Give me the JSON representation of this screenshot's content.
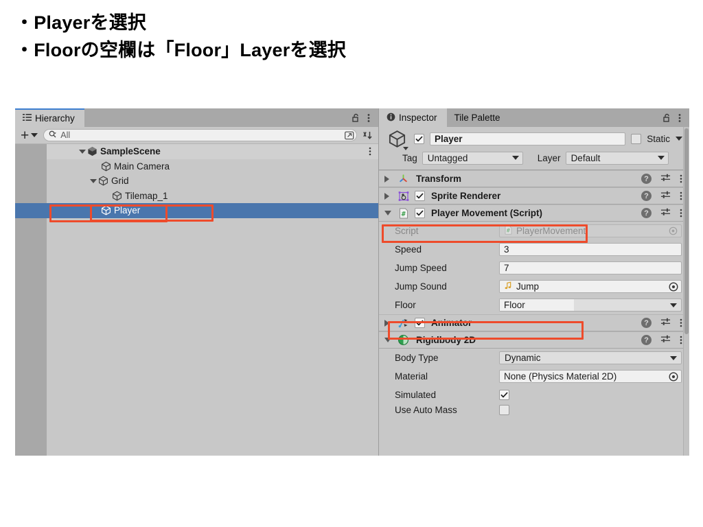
{
  "slide": {
    "lines": [
      "・Playerを選択",
      "・Floorの空欄は「Floor」Layerを選択"
    ]
  },
  "hierarchy": {
    "tab_label": "Hierarchy",
    "tab_icon": "hierarchy-list-icon",
    "lock_icon": "lock-open-icon",
    "menu_icon": "kebab-menu-icon",
    "toolbar": {
      "add_label": "+",
      "search_placeholder": "All",
      "search_value": "",
      "search_icon": "search-icon",
      "picker_icon": "open-in-new-icon",
      "sort_icon": "sort-alpha-icon"
    },
    "rows": [
      {
        "label": "SampleScene",
        "depth": 0,
        "expanded": true,
        "icon": "unity-scene-icon",
        "selected": false,
        "has_menu": true
      },
      {
        "label": "Main Camera",
        "depth": 1,
        "expanded": null,
        "icon": "gameobject-cube-icon",
        "selected": false,
        "has_menu": false
      },
      {
        "label": "Grid",
        "depth": 1,
        "expanded": true,
        "icon": "gameobject-cube-icon",
        "selected": false,
        "has_menu": false
      },
      {
        "label": "Tilemap_1",
        "depth": 2,
        "expanded": null,
        "icon": "gameobject-cube-icon",
        "selected": false,
        "has_menu": false
      },
      {
        "label": "Player",
        "depth": 1,
        "expanded": null,
        "icon": "gameobject-cube-icon",
        "selected": true,
        "has_menu": false
      }
    ]
  },
  "inspector": {
    "tabs": [
      {
        "label": "Inspector",
        "active": true,
        "icon": "info-circle-icon"
      },
      {
        "label": "Tile Palette",
        "active": false,
        "icon": ""
      }
    ],
    "lock_icon": "lock-open-icon",
    "menu_icon": "kebab-menu-icon",
    "header": {
      "object_icon": "gameobject-cube-icon",
      "enabled": true,
      "name": "Player",
      "static_label": "Static",
      "static_checked": false,
      "tag_label": "Tag",
      "tag_value": "Untagged",
      "layer_label": "Layer",
      "layer_value": "Default"
    },
    "components": [
      {
        "name": "Transform",
        "icon": "transform-axis-icon",
        "expanded": false,
        "has_enable_checkbox": false,
        "enabled": false,
        "properties": []
      },
      {
        "name": "Sprite Renderer",
        "icon": "sprite-renderer-icon",
        "expanded": false,
        "has_enable_checkbox": true,
        "enabled": true,
        "properties": []
      },
      {
        "name": "Player Movement (Script)",
        "icon": "csharp-script-icon",
        "expanded": true,
        "has_enable_checkbox": true,
        "enabled": true,
        "highlighted": true,
        "properties": [
          {
            "label": "Script",
            "type": "object",
            "value": "PlayerMovement",
            "icon": "csharp-script-icon",
            "disabled": true
          },
          {
            "label": "Speed",
            "type": "text",
            "value": "3"
          },
          {
            "label": "Jump Speed",
            "type": "text",
            "value": "7"
          },
          {
            "label": "Jump Sound",
            "type": "object",
            "value": "Jump",
            "icon": "audio-clip-icon",
            "disabled": false
          },
          {
            "label": "Floor",
            "type": "layermask",
            "value": "Floor",
            "highlighted": true
          }
        ]
      },
      {
        "name": "Animator",
        "icon": "animator-icon",
        "expanded": false,
        "has_enable_checkbox": true,
        "enabled": true,
        "properties": []
      },
      {
        "name": "Rigidbody 2D",
        "icon": "rigidbody2d-icon",
        "expanded": true,
        "has_enable_checkbox": false,
        "enabled": false,
        "properties": [
          {
            "label": "Body Type",
            "type": "dropdown",
            "value": "Dynamic"
          },
          {
            "label": "Material",
            "type": "object",
            "value": "None (Physics Material 2D)"
          },
          {
            "label": "Simulated",
            "type": "checkbox",
            "value": true
          },
          {
            "label": "Use Auto Mass",
            "type": "checkbox",
            "value": false,
            "clipped": true
          }
        ]
      }
    ],
    "help_icon": "help-circle-icon",
    "preset_icon": "preset-sliders-icon"
  },
  "colors": {
    "panel_bg": "#c8c8c8",
    "tab_inactive": "#a8a8a8",
    "selection_blue": "#4a76ad",
    "annotation_red": "#ee4b2b",
    "focus_blue": "#3d7fd1"
  }
}
